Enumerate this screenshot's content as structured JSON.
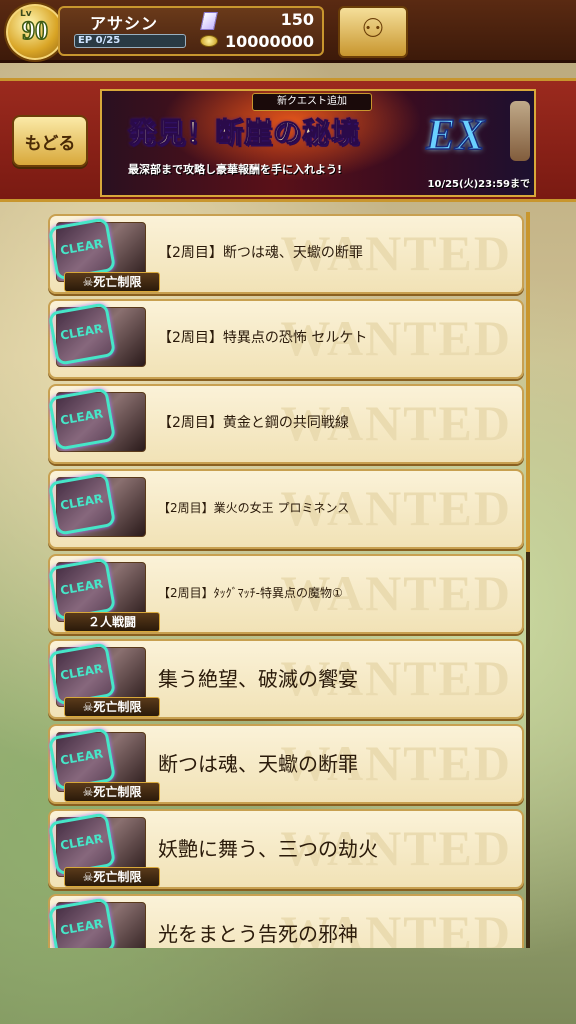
{
  "player": {
    "level_label": "Lv",
    "level": "90",
    "name": "アサシン",
    "ep": "EP 0/25",
    "crystals": "150",
    "gold": "10000000"
  },
  "nav": {
    "back_label": "もどる"
  },
  "banner": {
    "tag": "新クエスト追加",
    "title": "発見！断崖の秘境",
    "ex": "EX",
    "subtitle": "最深部まで攻略し豪華報酬を手に入れよう!",
    "date": "10/25(火)23:59まで"
  },
  "watermark": "WANTED",
  "quests": [
    {
      "title": "【2周目】断つは魂、天蠍の断罪",
      "badge": "死亡制限",
      "size": "normal"
    },
    {
      "title": "【2周目】特異点の恐怖 セルケト",
      "badge": "",
      "size": "normal"
    },
    {
      "title": "【2周目】黄金と鋼の共同戦線",
      "badge": "",
      "size": "normal"
    },
    {
      "title": "【2周目】業火の女王 プロミネンス",
      "badge": "",
      "size": "small"
    },
    {
      "title": "【2周目】ﾀｯｸﾞﾏｯﾁ-特異点の魔物①",
      "badge": "２人戦闘",
      "size": "small"
    },
    {
      "title": "集う絶望、破滅の饗宴",
      "badge": "死亡制限",
      "size": "large"
    },
    {
      "title": "断つは魂、天蠍の断罪",
      "badge": "死亡制限",
      "size": "large"
    },
    {
      "title": "妖艶に舞う、三つの劫火",
      "badge": "死亡制限",
      "size": "large"
    },
    {
      "title": "光をまとう告死の邪神",
      "badge": "",
      "size": "large"
    }
  ],
  "icons": {
    "crystal": "crystal-icon",
    "gold": "gold-icon",
    "friends": "friends-icon",
    "clear": "clear-stamp-icon",
    "skull": "skull-icon"
  },
  "colors": {
    "accent": "#c8962e",
    "banner_red": "#9b2a1e",
    "card": "#fbf2d8",
    "stamp": "#46e6c8"
  }
}
